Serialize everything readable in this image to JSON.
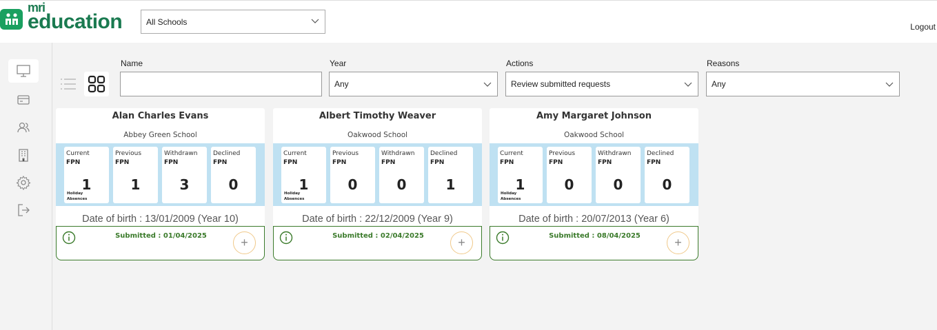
{
  "header": {
    "logo_small": "mri",
    "logo_text": "education",
    "school_select_value": "All Schools",
    "logout_label": "Logout"
  },
  "sidebar": {
    "items": [
      {
        "icon": "monitor-icon"
      },
      {
        "icon": "card-icon"
      },
      {
        "icon": "users-icon"
      },
      {
        "icon": "building-icon"
      },
      {
        "icon": "gear-icon"
      },
      {
        "icon": "logout-icon"
      }
    ]
  },
  "filters": {
    "name_label": "Name",
    "name_value": "",
    "year_label": "Year",
    "year_value": "Any",
    "actions_label": "Actions",
    "actions_value": "Review submitted requests",
    "reasons_label": "Reasons",
    "reasons_value": "Any"
  },
  "stat_labels": {
    "current": "Current",
    "previous": "Previous",
    "withdrawn": "Withdrawn",
    "declined": "Declined",
    "fpn": "FPN",
    "holiday_sub": "Holiday Absences"
  },
  "cards": [
    {
      "name": "Alan Charles Evans",
      "school": "Abbey Green School",
      "current": "1",
      "previous": "1",
      "withdrawn": "3",
      "declined": "0",
      "dob": "Date of birth : 13/01/2009 (Year 10)",
      "submitted": "Submitted : 01/04/2025"
    },
    {
      "name": "Albert Timothy Weaver",
      "school": "Oakwood School",
      "current": "1",
      "previous": "0",
      "withdrawn": "0",
      "declined": "1",
      "dob": "Date of birth : 22/12/2009 (Year 9)",
      "submitted": "Submitted : 02/04/2025"
    },
    {
      "name": "Amy Margaret Johnson",
      "school": "Oakwood School",
      "current": "1",
      "previous": "0",
      "withdrawn": "0",
      "declined": "0",
      "dob": "Date of birth : 20/07/2013 (Year 6)",
      "submitted": "Submitted : 08/04/2025"
    }
  ],
  "colors": {
    "brand": "#1a7a50",
    "stats_bg": "#bfe1f2",
    "submitted": "#3a7a2a"
  }
}
